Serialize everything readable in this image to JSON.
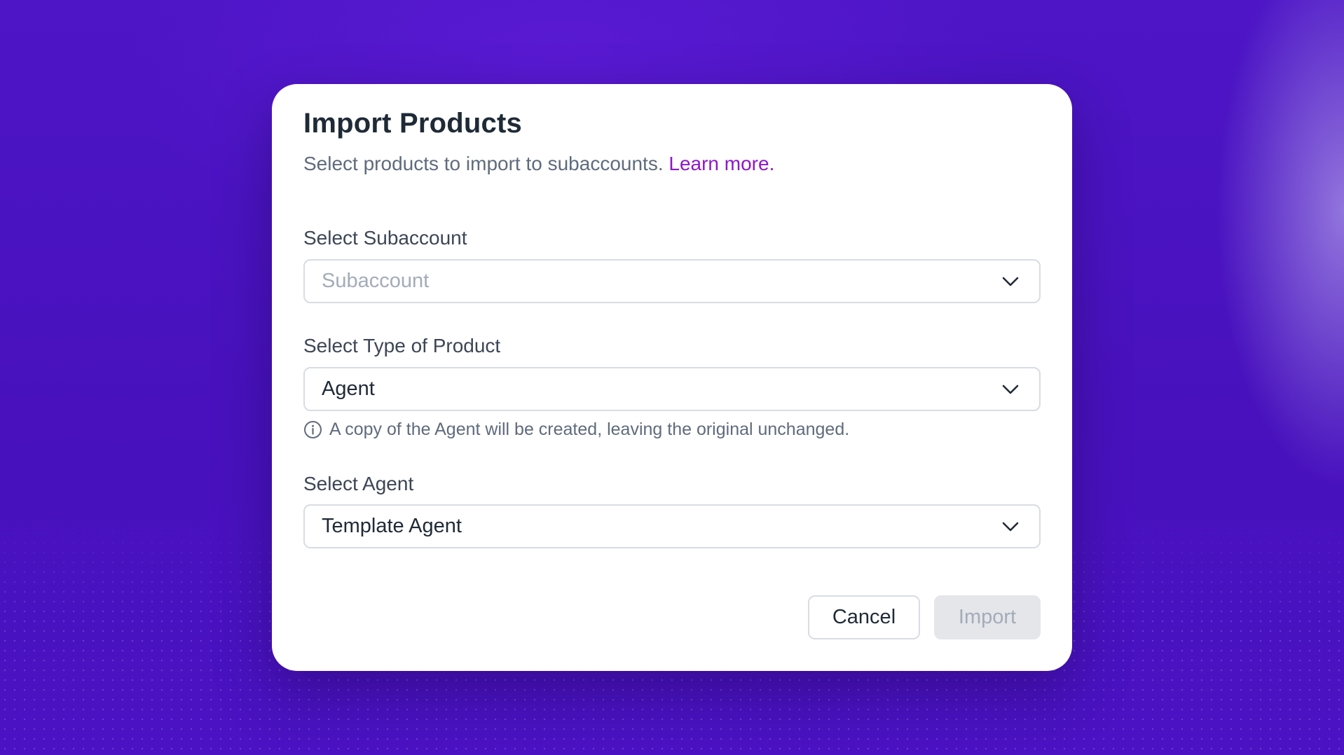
{
  "modal": {
    "title": "Import Products",
    "subtitle": "Select products to import to subaccounts.",
    "learn_more": "Learn more."
  },
  "fields": {
    "subaccount": {
      "label": "Select Subaccount",
      "placeholder": "Subaccount",
      "value": ""
    },
    "product_type": {
      "label": "Select Type of Product",
      "value": "Agent",
      "hint": "A copy of the Agent will be created, leaving the original unchanged."
    },
    "agent": {
      "label": "Select Agent",
      "value": "Template Agent"
    }
  },
  "actions": {
    "cancel_label": "Cancel",
    "import_label": "Import",
    "import_disabled": true
  },
  "icons": {
    "dropdown": "chevron-down-icon",
    "hint": "info-icon"
  },
  "colors": {
    "background": "#4a14c0",
    "link": "#8f17c9",
    "title": "#1f2a37",
    "disabled_button": "#e4e6ea"
  }
}
